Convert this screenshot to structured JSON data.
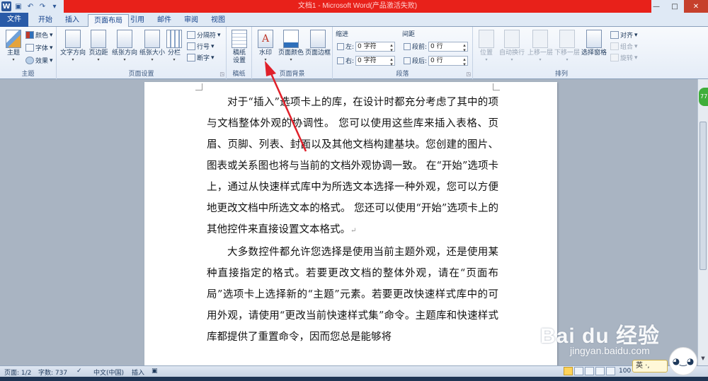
{
  "window": {
    "title": "文档1 - Microsoft Word(产品激活失败)",
    "controls": [
      "—",
      "□",
      "✕"
    ]
  },
  "tabs": {
    "file": "文件",
    "items": [
      "开始",
      "插入",
      "页面布局",
      "引用",
      "邮件",
      "审阅",
      "视图"
    ],
    "active": "页面布局"
  },
  "ribbon": {
    "theme_group": {
      "label": "主题",
      "big_button": "主题",
      "colors": "颜色",
      "fonts": "字体",
      "effects": "效果"
    },
    "page_setup_group": {
      "label": "页面设置",
      "buttons": [
        "文字方向",
        "页边距",
        "纸张方向",
        "纸张大小",
        "分栏"
      ],
      "breaks": "分隔符",
      "line_numbers": "行号",
      "hyphenation": "断字"
    },
    "draft_group": {
      "label": "稿纸",
      "button_line1": "稿纸",
      "button_line2": "设置"
    },
    "page_background_group": {
      "label": "页面背景",
      "buttons": [
        "水印",
        "页面颜色",
        "页面边框"
      ]
    },
    "paragraph_group": {
      "label": "段落",
      "indent_title": "缩进",
      "spacing_title": "间距",
      "indent_left_label": "左:",
      "indent_left_value": "0 字符",
      "indent_right_label": "右:",
      "indent_right_value": "0 字符",
      "spacing_before_label": "段前:",
      "spacing_before_value": "0 行",
      "spacing_after_label": "段后:",
      "spacing_after_value": "0 行"
    },
    "arrange_group": {
      "label": "排列",
      "buttons": [
        "位置",
        "自动换行",
        "上移一层",
        "下移一层",
        "选择窗格"
      ],
      "align": "对齐",
      "group": "组合",
      "rotate": "旋转"
    }
  },
  "document": {
    "paragraphs": [
      "对于“插入”选项卡上的库，在设计时都充分考虑了其中的项与文档整体外观的协调性。 您可以使用这些库来插入表格、页眉、页脚、列表、封面以及其他文档构建基块。您创建的图片、图表或关系图也将与当前的文档外观协调一致。 在“开始”选项卡上，通过从快速样式库中为所选文本选择一种外观，您可以方便地更改文档中所选文本的格式。 您还可以使用“开始”选项卡上的其他控件来直接设置文本格式。",
      "大多数控件都允许您选择是使用当前主题外观，还是使用某种直接指定的格式。若要更改文档的整体外观，请在“页面布局”选项卡上选择新的“主题”元素。若要更改快速样式库中的可用外观，请使用“更改当前快速样式集”命令。主题库和快速样式库都提供了重置命令，因而您总是能够将"
    ],
    "paragraph_mark": "↵"
  },
  "statusbar": {
    "page": "页面: 1/2",
    "words": "字数: 737",
    "language": "中文(中国)",
    "mode": "插入",
    "zoom": "100"
  },
  "overlay": {
    "watermark": "Bai du 经验",
    "watermark_sub": "jingyan.baidu.com",
    "ime": "英 ·, ",
    "badge": "77"
  },
  "colors": {
    "title_bar_red": "#e8211a",
    "file_tab_blue": "#2a5ba8",
    "annotation_arrow": "#e0202a"
  }
}
